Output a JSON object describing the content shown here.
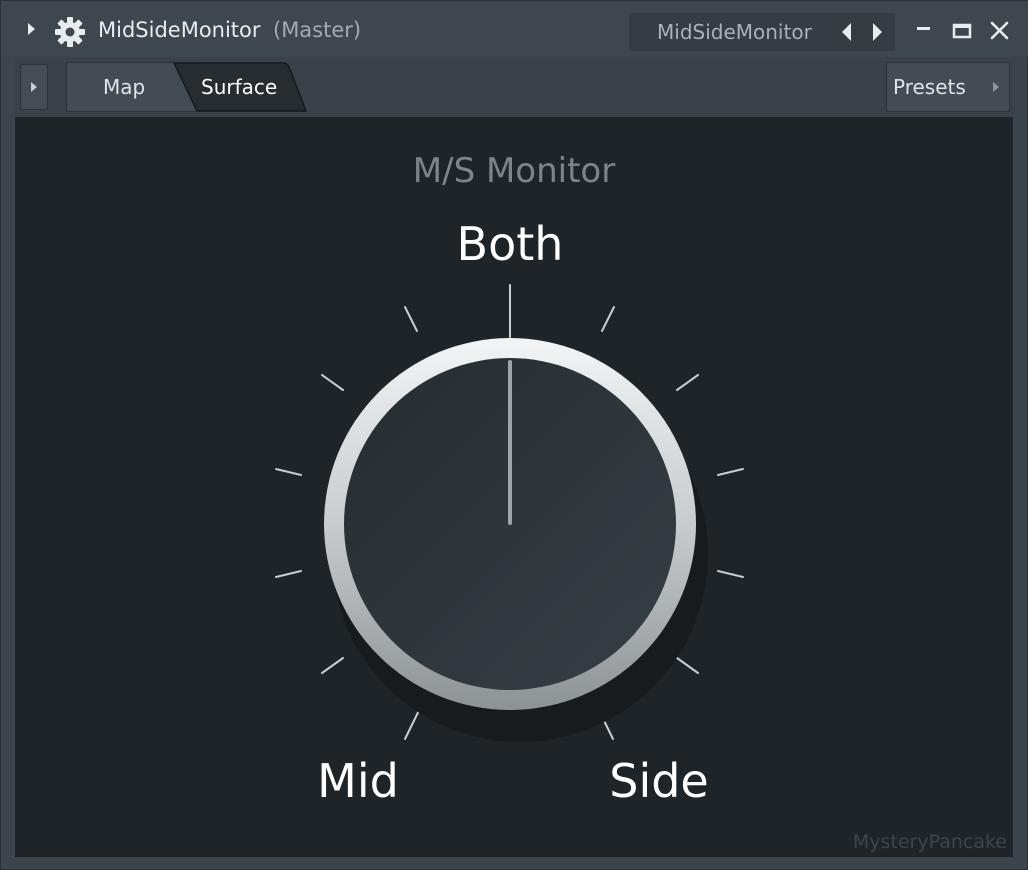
{
  "window": {
    "title": "MidSideMonitor",
    "subtitle": "(Master)",
    "preset_name": "MidSideMonitor",
    "icons": {
      "expand": "triangle-right-icon",
      "gear": "gear-icon",
      "prev": "triangle-left-icon",
      "next": "triangle-right-icon",
      "minimize": "minimize-icon",
      "maximize": "maximize-icon",
      "close": "close-icon"
    }
  },
  "tabs": [
    {
      "label": "Map",
      "active": false
    },
    {
      "label": "Surface",
      "active": true
    }
  ],
  "presets_label": "Presets",
  "surface": {
    "title": "M/S Monitor",
    "knob": {
      "labels": {
        "top": "Both",
        "left": "Mid",
        "right": "Side"
      },
      "value": "Both"
    },
    "watermark": "MysteryPancake"
  },
  "colors": {
    "background": "#1e2427",
    "knob_body": "#2c3338",
    "knob_ring": "#d6dadd",
    "label": "#ffffff",
    "title": "#7d8589"
  }
}
